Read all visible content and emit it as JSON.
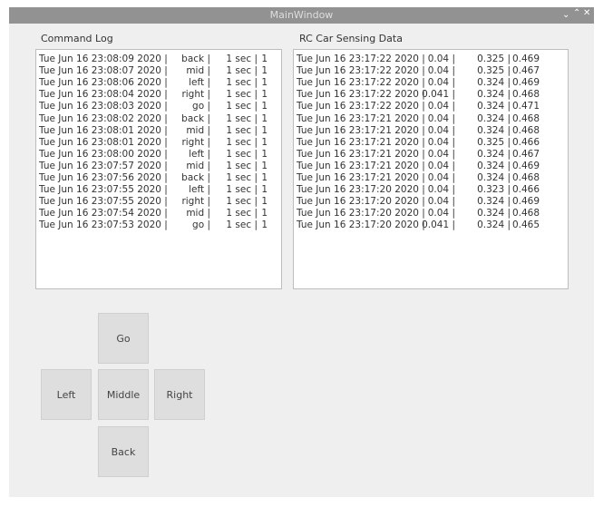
{
  "window": {
    "title": "MainWindow",
    "controls": {
      "minimize": "⌄",
      "maximize": "⌃",
      "close": "✕"
    }
  },
  "command_log": {
    "label": "Command Log",
    "rows": [
      {
        "time": "Tue Jun 16 23:08:09 2020 |",
        "cmd": "back |",
        "dur": "1 sec |",
        "n": "1"
      },
      {
        "time": "Tue Jun 16 23:08:07 2020 |",
        "cmd": "mid |",
        "dur": "1 sec |",
        "n": "1"
      },
      {
        "time": "Tue Jun 16 23:08:06 2020 |",
        "cmd": "left |",
        "dur": "1 sec |",
        "n": "1"
      },
      {
        "time": "Tue Jun 16 23:08:04 2020 |",
        "cmd": "right |",
        "dur": "1 sec |",
        "n": "1"
      },
      {
        "time": "Tue Jun 16 23:08:03 2020 |",
        "cmd": "go |",
        "dur": "1 sec |",
        "n": "1"
      },
      {
        "time": "Tue Jun 16 23:08:02 2020 |",
        "cmd": "back |",
        "dur": "1 sec |",
        "n": "1"
      },
      {
        "time": "Tue Jun 16 23:08:01 2020 |",
        "cmd": "mid |",
        "dur": "1 sec |",
        "n": "1"
      },
      {
        "time": "Tue Jun 16 23:08:01 2020 |",
        "cmd": "right |",
        "dur": "1 sec |",
        "n": "1"
      },
      {
        "time": "Tue Jun 16 23:08:00 2020 |",
        "cmd": "left |",
        "dur": "1 sec |",
        "n": "1"
      },
      {
        "time": "Tue Jun 16 23:07:57 2020 |",
        "cmd": "mid |",
        "dur": "1 sec |",
        "n": "1"
      },
      {
        "time": "Tue Jun 16 23:07:56 2020 |",
        "cmd": "back |",
        "dur": "1 sec |",
        "n": "1"
      },
      {
        "time": "Tue Jun 16 23:07:55 2020 |",
        "cmd": "left |",
        "dur": "1 sec |",
        "n": "1"
      },
      {
        "time": "Tue Jun 16 23:07:55 2020 |",
        "cmd": "right |",
        "dur": "1 sec |",
        "n": "1"
      },
      {
        "time": "Tue Jun 16 23:07:54 2020 |",
        "cmd": "mid |",
        "dur": "1 sec |",
        "n": "1"
      },
      {
        "time": "Tue Jun 16 23:07:53 2020 |",
        "cmd": "go |",
        "dur": "1 sec |",
        "n": "1"
      }
    ]
  },
  "sensing": {
    "label": "RC Car Sensing Data",
    "rows": [
      {
        "time": "Tue Jun 16 23:17:22 2020 |",
        "a": "0.04 |",
        "b": "0.325 |",
        "c": "0.469"
      },
      {
        "time": "Tue Jun 16 23:17:22 2020 |",
        "a": "0.04 |",
        "b": "0.325 |",
        "c": "0.467"
      },
      {
        "time": "Tue Jun 16 23:17:22 2020 |",
        "a": "0.04 |",
        "b": "0.324 |",
        "c": "0.469"
      },
      {
        "time": "Tue Jun 16 23:17:22 2020 |",
        "a": "0.041 |",
        "b": "0.324 |",
        "c": "0.468"
      },
      {
        "time": "Tue Jun 16 23:17:22 2020 |",
        "a": "0.04 |",
        "b": "0.324 |",
        "c": "0.471"
      },
      {
        "time": "Tue Jun 16 23:17:21 2020 |",
        "a": "0.04 |",
        "b": "0.324 |",
        "c": "0.468"
      },
      {
        "time": "Tue Jun 16 23:17:21 2020 |",
        "a": "0.04 |",
        "b": "0.324 |",
        "c": "0.468"
      },
      {
        "time": "Tue Jun 16 23:17:21 2020 |",
        "a": "0.04 |",
        "b": "0.325 |",
        "c": "0.466"
      },
      {
        "time": "Tue Jun 16 23:17:21 2020 |",
        "a": "0.04 |",
        "b": "0.324 |",
        "c": "0.467"
      },
      {
        "time": "Tue Jun 16 23:17:21 2020 |",
        "a": "0.04 |",
        "b": "0.324 |",
        "c": "0.469"
      },
      {
        "time": "Tue Jun 16 23:17:21 2020 |",
        "a": "0.04 |",
        "b": "0.324 |",
        "c": "0.468"
      },
      {
        "time": "Tue Jun 16 23:17:20 2020 |",
        "a": "0.04 |",
        "b": "0.323 |",
        "c": "0.466"
      },
      {
        "time": "Tue Jun 16 23:17:20 2020 |",
        "a": "0.04 |",
        "b": "0.324 |",
        "c": "0.469"
      },
      {
        "time": "Tue Jun 16 23:17:20 2020 |",
        "a": "0.04 |",
        "b": "0.324 |",
        "c": "0.468"
      },
      {
        "time": "Tue Jun 16 23:17:20 2020 |",
        "a": "0.041 |",
        "b": "0.324 |",
        "c": "0.465"
      }
    ]
  },
  "controls": {
    "go": "Go",
    "left": "Left",
    "middle": "Middle",
    "right": "Right",
    "back": "Back"
  }
}
